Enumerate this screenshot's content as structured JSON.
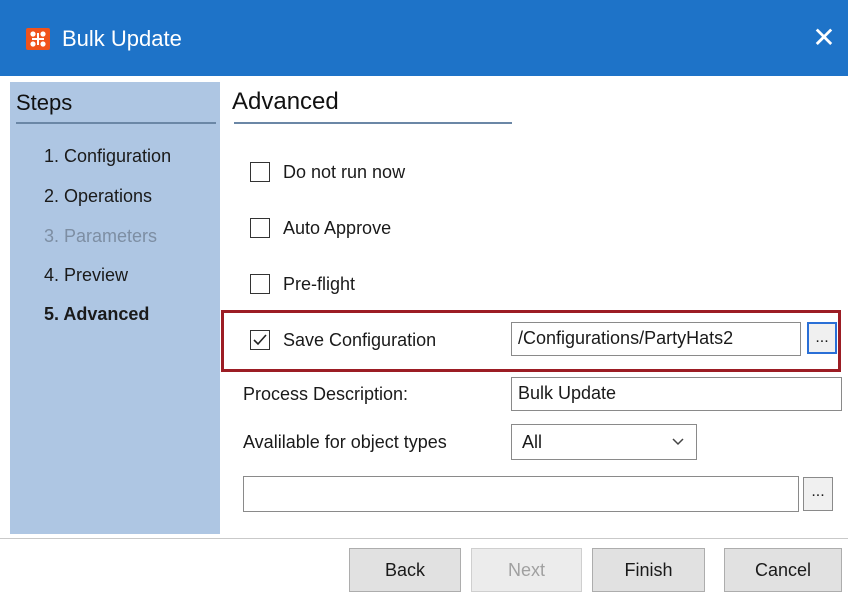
{
  "window": {
    "title": "Bulk Update",
    "close_glyph": "✕",
    "icon": "app-logo-icon"
  },
  "steps": {
    "title": "Steps",
    "items": [
      {
        "label": "1. Configuration",
        "state": "normal"
      },
      {
        "label": "2. Operations",
        "state": "normal"
      },
      {
        "label": "3. Parameters",
        "state": "disabled"
      },
      {
        "label": "4. Preview",
        "state": "normal"
      },
      {
        "label": "5. Advanced",
        "state": "active"
      }
    ]
  },
  "main": {
    "title": "Advanced",
    "options": {
      "do_not_run_now": {
        "label": "Do not run now",
        "checked": false
      },
      "auto_approve": {
        "label": "Auto Approve",
        "checked": false
      },
      "pre_flight": {
        "label": "Pre-flight",
        "checked": false
      },
      "save_configuration": {
        "label": "Save Configuration",
        "checked": true,
        "path": "/Configurations/PartyHats2",
        "browse_label": "..."
      }
    },
    "process_description": {
      "label": "Process Description:",
      "value": "Bulk Update"
    },
    "object_types": {
      "label": "Avalilable for object types",
      "selected": "All"
    },
    "extra_field": {
      "value": "",
      "browse_label": "..."
    }
  },
  "footer": {
    "back": "Back",
    "next": "Next",
    "finish": "Finish",
    "cancel": "Cancel"
  },
  "colors": {
    "title_bar": "#1e73c8",
    "steps_panel": "#aec6e3",
    "highlight_border": "#9c1d24",
    "app_icon": "#f0531c"
  }
}
